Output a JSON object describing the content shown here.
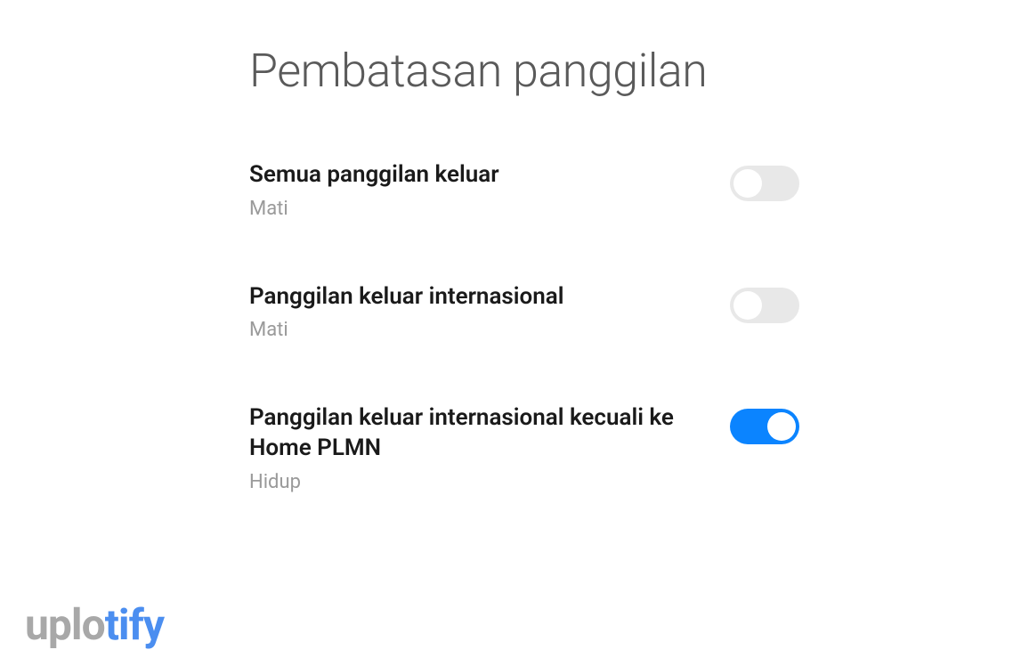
{
  "page": {
    "title": "Pembatasan panggilan"
  },
  "settings": [
    {
      "label": "Semua panggilan keluar",
      "status": "Mati",
      "enabled": false
    },
    {
      "label": "Panggilan keluar internasional",
      "status": "Mati",
      "enabled": false
    },
    {
      "label": "Panggilan keluar internasional kecuali ke Home PLMN",
      "status": "Hidup",
      "enabled": true
    }
  ],
  "watermark": {
    "part1": "uplo",
    "part2": "tify"
  }
}
